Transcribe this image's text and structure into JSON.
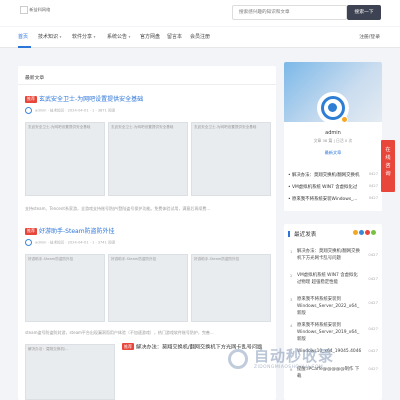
{
  "header": {
    "logo_alt": "logo",
    "logo_text": "新益科网络",
    "search_placeholder": "搜索感兴趣的知识和文章",
    "search_button": "搜索一下"
  },
  "nav": {
    "items": [
      "首页",
      "技术知识",
      "软件分享",
      "系统公告",
      "官方网盘",
      "留言本",
      "会员注册"
    ],
    "login": "注册/登录"
  },
  "main": {
    "section_title": "最新文章",
    "posts": [
      {
        "badge": "推荐",
        "title": "玄武安全卫士-为网吧设置提供安全基础",
        "author": "admin",
        "category": "技术知识",
        "date": "2024-04-01",
        "views": "1",
        "likes": "3871 阅读",
        "thumbs": [
          "玄武安全卫士-为网吧设置提供安全基础",
          "玄武安全卫士-为网吧设置提供安全基础",
          "玄武安全卫士-为网吧设置提供安全基础"
        ],
        "excerpt": "支持steam、Tencent系家游，全游戏支持账号防护/登陆盗号保护功能。免费体验试用，满意后再续费..."
      },
      {
        "badge": "推荐",
        "title": "好游助手-Steam防盗防外挂",
        "author": "admin",
        "category": "技术知识",
        "date": "2024-04-01",
        "views": "1",
        "likes": "3741 阅读",
        "thumbs": [
          "好游助手-Steam防盗防外挂",
          "好游助手-Steam防盗防外挂",
          "好游助手-Steam防盗防外挂"
        ],
        "excerpt": "steam盗号防盗防封游，steam平台出现漏洞而用户体验（不加速游戏），热门游戏软件账号防护，完善..."
      }
    ],
    "post3": {
      "thumb": "解决办法：莫翔交换机/...",
      "badge": "推荐",
      "title": "解决办法：莫翔交换机/翻网交换机下方光网卡乱号问题"
    }
  },
  "sidebar": {
    "profile": {
      "name": "admin",
      "stats": "文章 38 篇 | 日活 0 次",
      "sub": "最新文章"
    },
    "latest": [
      {
        "text": "解决办法：莫翔交换机/翻网交换机",
        "num": "0427"
      },
      {
        "text": "VM虚拟机系统 WIN7 含虚拟化过",
        "num": "0427"
      },
      {
        "text": "原来我不将系统安装Windows_...",
        "num": "0427"
      }
    ],
    "side_tab": [
      "在",
      "线",
      "咨",
      "询"
    ],
    "recent": {
      "title": "最近发表",
      "dot_colors": [
        "#f5a623",
        "#3b88d8",
        "#e8463a",
        "#7ac143"
      ],
      "items": [
        {
          "num": "1",
          "text": "解决办法：莫翔交换机/翻网交换机下方光网卡乱号问题",
          "date": "0427"
        },
        {
          "num": "2",
          "text": "VM虚拟机系统 WIN7 含虚拟化过物理 超强稳定性能",
          "date": "0427"
        },
        {
          "num": "3",
          "text": "原来我不将系统安装到 Windows_Server_2022_x64_新版",
          "date": "0427"
        },
        {
          "num": "4",
          "text": "原来我不将系统安装到 Windows_Server_2019_x64_新版",
          "date": "0427"
        },
        {
          "num": "5",
          "text": "Windows10_x64_19045.4046",
          "date": "0427"
        },
        {
          "num": "6",
          "text": "提醒:IPCaffe@@@@@制作 下载",
          "date": "0427"
        }
      ]
    }
  },
  "watermark": {
    "text": "自动秒收录",
    "sub": "ZIDONGMIAOSHOULU.COM"
  }
}
